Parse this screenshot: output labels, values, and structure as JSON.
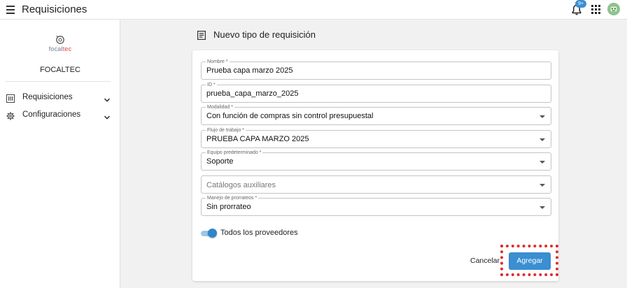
{
  "header": {
    "menu_icon": "hamburger-menu-icon",
    "title": "Requisiciones",
    "notifications_icon": "bell-icon",
    "notifications_badge": "9+",
    "apps_icon": "grid-apps-icon",
    "avatar_icon": "user-avatar-icon"
  },
  "sidebar": {
    "logo": {
      "part1": "focal",
      "part2": "tec"
    },
    "company": "FOCALTEC",
    "items": [
      {
        "label": "Requisiciones",
        "icon": "list-icon",
        "expand_icon": "chevron-down-icon"
      },
      {
        "label": "Configuraciones",
        "icon": "gear-icon",
        "expand_icon": "chevron-down-icon"
      }
    ]
  },
  "main": {
    "title": "Nuevo tipo de requisición",
    "title_icon": "document-icon"
  },
  "form": {
    "nombre": {
      "label": "Nombre *",
      "value": "Prueba capa marzo 2025"
    },
    "id": {
      "label": "ID *",
      "value": "prueba_capa_marzo_2025"
    },
    "modalidad": {
      "label": "Modalidad *",
      "value": "Con función de compras sin control presupuestal"
    },
    "flujo": {
      "label": "Flujo de trabajo *",
      "value": "PRUEBA CAPA MARZO 2025"
    },
    "equipo": {
      "label": "Equipo predeterminado *",
      "value": "Soporte"
    },
    "catalogos": {
      "placeholder": "Catálogos auxiliares"
    },
    "prorrateos": {
      "label": "Manejo de prorrateos *",
      "value": "Sin prorrateo"
    },
    "toggle": {
      "label": "Todos los proveedores",
      "checked": true
    },
    "cancel_label": "Cancelar",
    "submit_label": "Agregar"
  },
  "colors": {
    "accent": "#3a8ed1",
    "highlight": "#e02b2b",
    "toggle_thumb": "#2f86c8",
    "toggle_track": "#9cc6e6"
  }
}
